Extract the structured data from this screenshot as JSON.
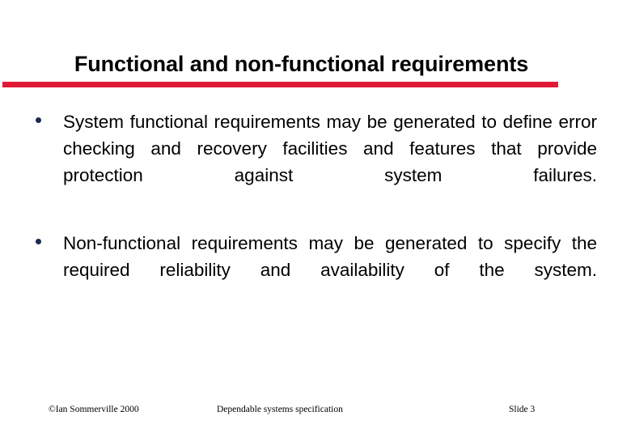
{
  "slide": {
    "title": "Functional and non-functional requirements",
    "accent_color": "#e01a36",
    "bullet_color": "#1c2951",
    "background_color": "#ffffff",
    "text_color": "#000000",
    "bullets": [
      {
        "marker": "bullet-dot",
        "text": "System functional requirements may be generated to define error checking and recovery facilities and features that provide protection against system failures."
      },
      {
        "marker": "bullet-dot",
        "text": "Non-functional requirements may be generated to specify the required reliability and availability of the system."
      }
    ]
  },
  "footer": {
    "copyright": "©Ian Sommerville 2000",
    "topic": "Dependable systems specification",
    "slide_number": "Slide 3"
  }
}
